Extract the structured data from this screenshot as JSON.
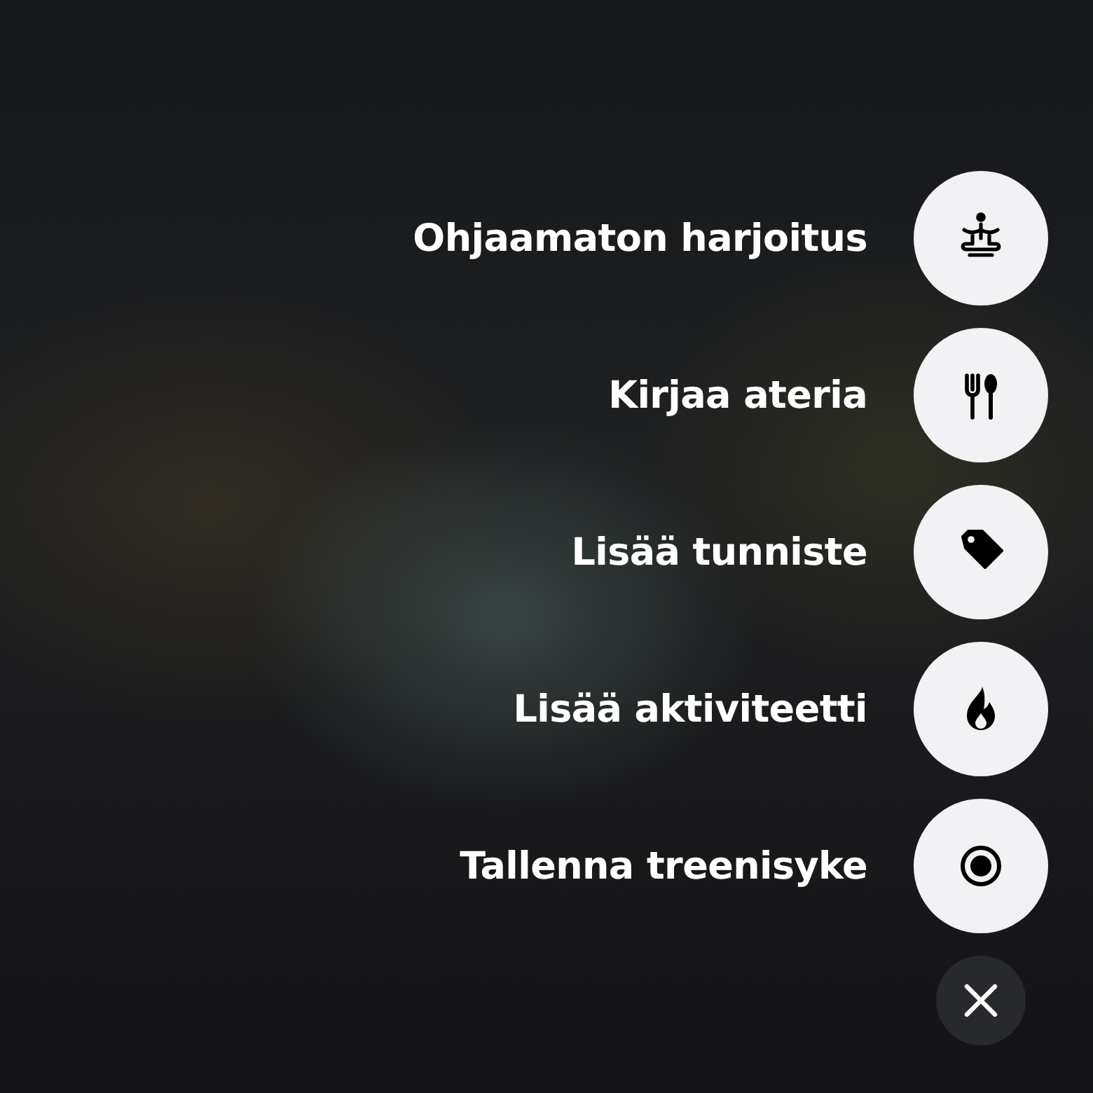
{
  "actions": [
    {
      "label": "Ohjaamaton harjoitus",
      "kind": "meditation"
    },
    {
      "label": "Kirjaa ateria",
      "kind": "meal"
    },
    {
      "label": "Lisää tunniste",
      "kind": "tag"
    },
    {
      "label": "Lisää aktiviteetti",
      "kind": "flame"
    },
    {
      "label": "Tallenna treenisyke",
      "kind": "record"
    }
  ]
}
